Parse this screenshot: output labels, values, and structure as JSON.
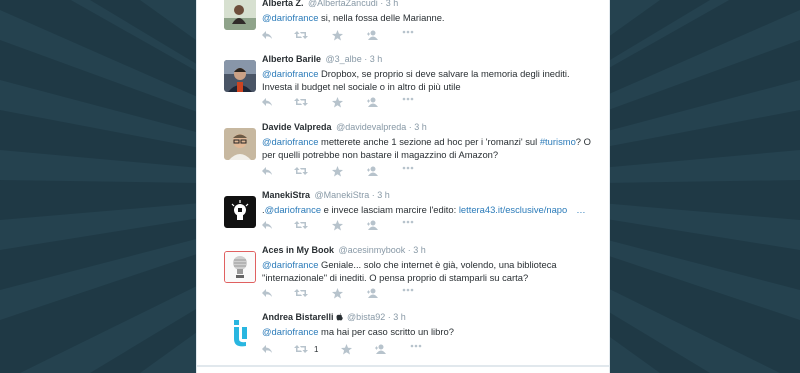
{
  "tweets": [
    {
      "name": "Alberta Z.",
      "handle": "@AlbertaZancudi",
      "time": "3 h",
      "mention": "@dariofrance",
      "text": " si, nella fossa delle Marianne.",
      "avatar": "avatar-photo-woman"
    },
    {
      "name": "Alberto Barile",
      "handle": "@3_albe",
      "time": "3 h",
      "mention": "@dariofrance",
      "text": " Dropbox, se proprio si deve salvare la memoria degli inediti. Investa il budget nel sociale o in altro di più utile",
      "avatar": "avatar-photo-man"
    },
    {
      "name": "Davide Valpreda",
      "handle": "@davidevalpreda",
      "time": "3 h",
      "mention": "@dariofrance",
      "text": " metterete anche 1 sezione ad hoc per i 'romanzi' sul ",
      "hashtag": "#turismo",
      "text2": "? O per quelli potrebbe non bastare il magazzino di Amazon?",
      "avatar": "avatar-photo-man-glasses"
    },
    {
      "name": "ManekiStra",
      "handle": "@ManekiStra",
      "time": "3 h",
      "prefix": ".",
      "mention": "@dariofrance",
      "text": " e invece lasciam marcire l'edito: ",
      "link": "lettera43.it/esclusive/napo",
      "ellipsis": "…",
      "avatar": "avatar-lightbulb-logo"
    },
    {
      "name": "Aces in My Book",
      "handle": "@acesinmybook",
      "time": "3 h",
      "mention": "@dariofrance",
      "text": " Geniale... solo che internet è già, volendo, una biblioteca \"internazionale\" di inediti. O pensa proprio di stamparli su carta?",
      "avatar": "avatar-lightbulb-sketch"
    },
    {
      "name": "Andrea Bistarelli",
      "handle": "@bista92",
      "time": "3 h",
      "mention": "@dariofrance",
      "text": " ma hai per caso scritto un libro?",
      "retweet_count": "1",
      "avatar": "avatar-bista-logo"
    }
  ],
  "time_sep": " · ",
  "icons": {
    "reply": "reply-icon",
    "retweet": "retweet-icon",
    "favorite": "star-icon",
    "follow": "follow-icon",
    "more": "more-icon"
  },
  "colors": {
    "link": "#2b7bb9",
    "background": "#25424f",
    "name": "#292f33",
    "meta": "#8899a6",
    "icon": "#b7c3cc"
  }
}
